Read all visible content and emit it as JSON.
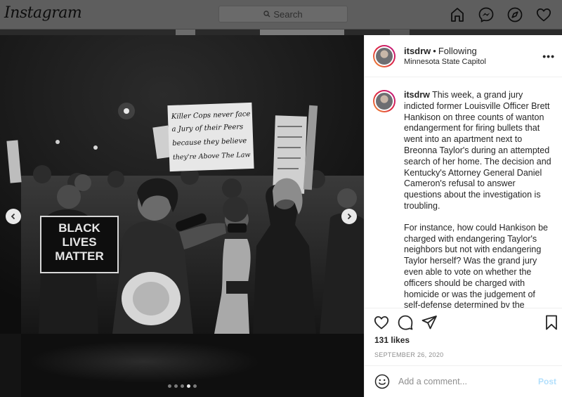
{
  "app": {
    "logo": "Instagram"
  },
  "search": {
    "placeholder": "Search"
  },
  "nav": {
    "icons": [
      "home-icon",
      "messenger-icon",
      "explore-icon",
      "heart-icon"
    ]
  },
  "photo": {
    "signs": {
      "main": [
        "Killer Cops never face",
        "a Jury of their Peers",
        "because they believe",
        "they're Above The Law"
      ],
      "blm": [
        "BLACK",
        "LIVES",
        "MATTER"
      ]
    },
    "carousel": {
      "count": 5,
      "active_index": 4
    }
  },
  "post": {
    "username": "itsdrw",
    "separator": "•",
    "follow_status": "Following",
    "location": "Minnesota State Capitol",
    "more": "•••",
    "caption_paragraphs": [
      "This week, a grand jury indicted former Louisville Officer Brett Hankison on three counts of wanton endangerment for firing bullets that went into an apartment next to Breonna Taylor's during an attempted search of her home. The decision and Kentucky's Attorney General Daniel Cameron's refusal to answer questions about the investigation is troubling.",
      "For instance, how could Hankison be charged with endangering Taylor's neighbors but not with endangering Taylor herself? Was the grand jury even able to vote on whether the officers should be charged with homicide or was the judgement of self-defense determined by the Attorney General?"
    ],
    "likes": "131 likes",
    "date": "SEPTEMBER 26, 2020",
    "comment_placeholder": "Add a comment...",
    "post_button": "Post"
  },
  "colors": {
    "brand_blue_disabled": "#b2dffc",
    "muted": "#8e8e8e",
    "text": "#262626"
  }
}
